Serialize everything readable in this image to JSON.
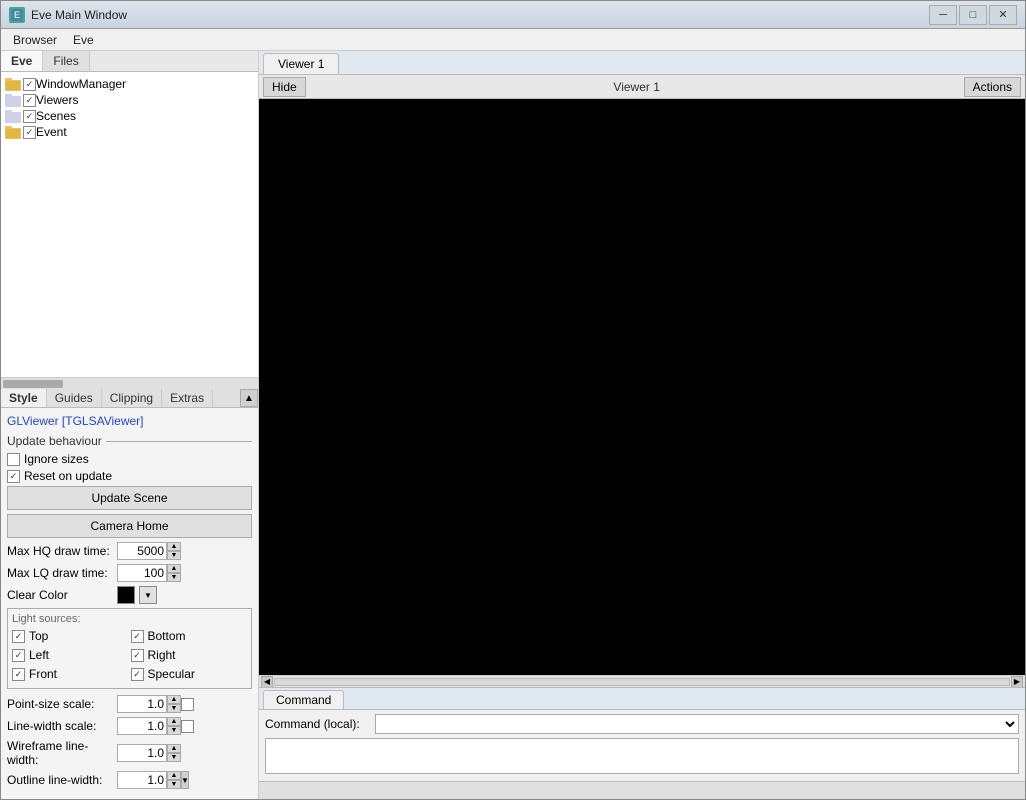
{
  "window": {
    "title": "Eve Main Window",
    "icon": "E"
  },
  "titlebar_controls": {
    "minimize": "─",
    "maximize": "□",
    "close": "✕"
  },
  "menubar": {
    "items": [
      "Browser",
      "Eve"
    ]
  },
  "left_tabs": {
    "items": [
      "Eve",
      "Files"
    ]
  },
  "tree": {
    "items": [
      {
        "label": "WindowManager",
        "indent": 0
      },
      {
        "label": "Viewers",
        "indent": 0
      },
      {
        "label": "Scenes",
        "indent": 0
      },
      {
        "label": "Event",
        "indent": 0
      }
    ]
  },
  "props_tabs": {
    "items": [
      "Style",
      "Guides",
      "Clipping",
      "Extras"
    ]
  },
  "props": {
    "viewer_link": "GLViewer [TGLSAViewer]",
    "update_behaviour_label": "Update behaviour",
    "ignore_sizes_label": "Ignore sizes",
    "reset_on_update_label": "Reset on update",
    "update_scene_btn": "Update Scene",
    "camera_home_btn": "Camera Home",
    "max_hq_label": "Max HQ draw time:",
    "max_hq_value": "5000",
    "max_lq_label": "Max LQ draw time:",
    "max_lq_value": "100",
    "clear_color_label": "Clear Color",
    "light_sources_label": "Light sources:",
    "lights": [
      {
        "label": "Top",
        "checked": true
      },
      {
        "label": "Bottom",
        "checked": true
      },
      {
        "label": "Left",
        "checked": true
      },
      {
        "label": "Right",
        "checked": true
      },
      {
        "label": "Front",
        "checked": true
      },
      {
        "label": "Specular",
        "checked": true
      }
    ],
    "point_size_label": "Point-size scale:",
    "point_size_value": "1.0",
    "line_width_label": "Line-width scale:",
    "line_width_value": "1.0",
    "wireframe_label": "Wireframe line-width:",
    "wireframe_value": "1.0",
    "outline_label": "Outline line-width:",
    "outline_value": "1.0"
  },
  "viewer": {
    "tabs": [
      "Viewer 1"
    ],
    "active_tab": "Viewer 1",
    "hide_btn": "Hide",
    "title": "Viewer 1",
    "actions_btn": "Actions"
  },
  "command": {
    "tab_label": "Command",
    "local_label": "Command (local):",
    "local_placeholder": ""
  },
  "statusbar": {
    "segments": [
      "",
      "",
      "",
      "",
      "",
      ""
    ]
  }
}
